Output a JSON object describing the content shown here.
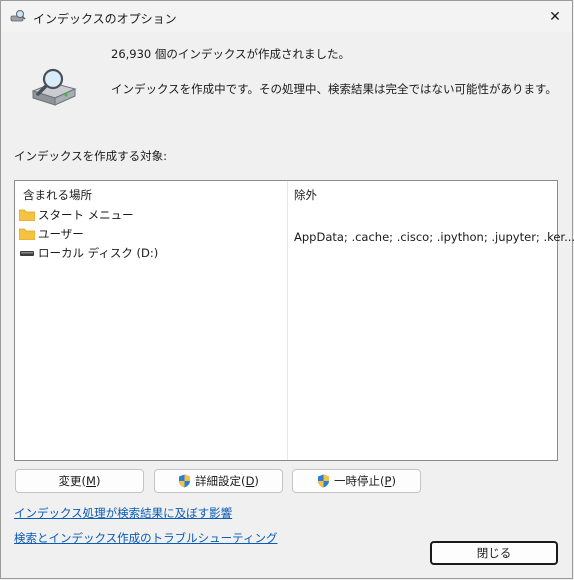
{
  "window": {
    "title": "インデックスのオプション",
    "close_glyph": "✕"
  },
  "status": {
    "count_line": "26,930 個のインデックスが作成されました。",
    "progress_line": "インデックスを作成中です。その処理中、検索結果は完全ではない可能性があります。"
  },
  "section": {
    "label": "インデックスを作成する対象:"
  },
  "list": {
    "headers": {
      "included": "含まれる場所",
      "excluded": "除外"
    },
    "items": [
      {
        "label": "スタート メニュー",
        "icon": "folder-icon",
        "exclude": ""
      },
      {
        "label": "ユーザー",
        "icon": "folder-icon",
        "exclude": "AppData; .cache; .cisco; .ipython; .jupyter; .ker..."
      },
      {
        "label": "ローカル ディスク (D:)",
        "icon": "drive-icon",
        "exclude": ""
      }
    ]
  },
  "buttons": {
    "modify": {
      "text": "変更(",
      "accel": "M",
      "tail": ")"
    },
    "advanced": {
      "text": "詳細設定(",
      "accel": "D",
      "tail": ")"
    },
    "pause": {
      "text": "一時停止(",
      "accel": "P",
      "tail": ")"
    },
    "close": "閉じる"
  },
  "links": {
    "impact": "インデックス処理が検索結果に及ぼす影響",
    "troubleshoot": "検索とインデックス作成のトラブルシューティング"
  },
  "colors": {
    "link": "#0a5bb5",
    "folder": "#f5c242",
    "background": "#f0f0f0"
  }
}
